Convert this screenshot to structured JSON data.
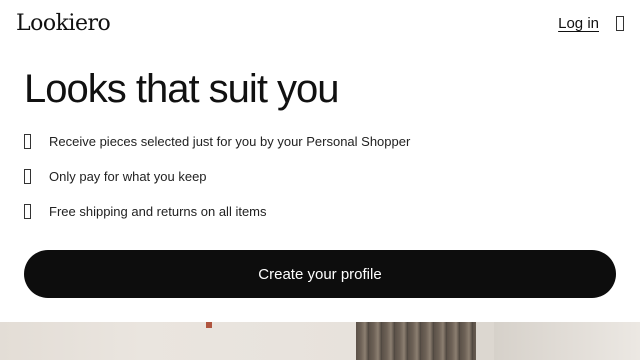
{
  "header": {
    "logo": "Lookiero",
    "login_label": "Log in",
    "menu_icon": "menu-icon"
  },
  "hero": {
    "title": "Looks that suit you"
  },
  "benefits": [
    {
      "icon": "check-icon",
      "text": "Receive pieces selected just for you by your Personal Shopper"
    },
    {
      "icon": "check-icon",
      "text": "Only pay for what you keep"
    },
    {
      "icon": "check-icon",
      "text": "Free shipping and returns on all items"
    }
  ],
  "cta": {
    "label": "Create your profile",
    "background": "#0d0d0d",
    "text_color": "#ffffff"
  }
}
